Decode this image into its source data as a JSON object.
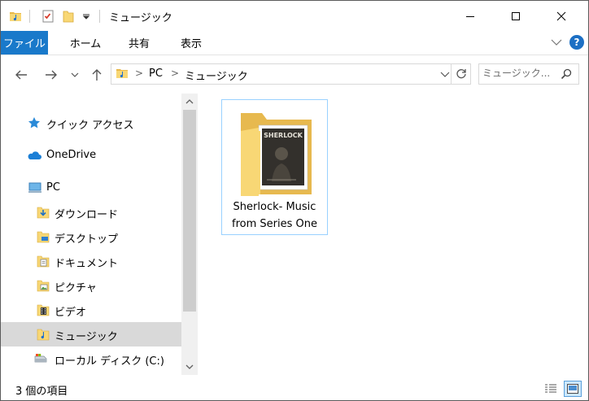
{
  "window": {
    "title": "ミュージック"
  },
  "quick_access_icons": [
    "music-folder-icon",
    "properties-icon",
    "new-folder-icon",
    "customize-dropdown-icon"
  ],
  "window_controls": [
    "minimize-icon",
    "maximize-icon",
    "close-icon"
  ],
  "ribbon": {
    "tabs": [
      {
        "label": "ファイル",
        "active": true
      },
      {
        "label": "ホーム"
      },
      {
        "label": "共有"
      },
      {
        "label": "表示"
      }
    ],
    "help_label": "?"
  },
  "address": {
    "breadcrumbs": [
      "PC",
      "ミュージック"
    ],
    "separator": ">"
  },
  "search": {
    "placeholder": "ミュージック..."
  },
  "nav_pane": {
    "items": [
      {
        "label": "クイック アクセス",
        "icon": "star-icon"
      },
      {
        "label": "OneDrive",
        "icon": "cloud-icon"
      },
      {
        "label": "PC",
        "icon": "pc-icon"
      },
      {
        "label": "ダウンロード",
        "icon": "downloads-folder-icon"
      },
      {
        "label": "デスクトップ",
        "icon": "desktop-folder-icon"
      },
      {
        "label": "ドキュメント",
        "icon": "documents-folder-icon"
      },
      {
        "label": "ピクチャ",
        "icon": "pictures-folder-icon"
      },
      {
        "label": "ビデオ",
        "icon": "videos-folder-icon"
      },
      {
        "label": "ミュージック",
        "icon": "music-folder-icon",
        "selected": true
      },
      {
        "label": "ローカル ディスク (C:)",
        "icon": "drive-icon"
      }
    ]
  },
  "content": {
    "items": [
      {
        "name_line1": "Sherlock- Music",
        "name_line2": "from Series One",
        "cover_text": "SHERLOCK",
        "icon": "folder-with-album-art-icon"
      }
    ]
  },
  "status": {
    "text": "3 個の項目"
  },
  "colors": {
    "accent": "#1979ca",
    "selection": "#d9d9d9",
    "tile_border": "#99d1ff",
    "folder": "#f8d775"
  }
}
